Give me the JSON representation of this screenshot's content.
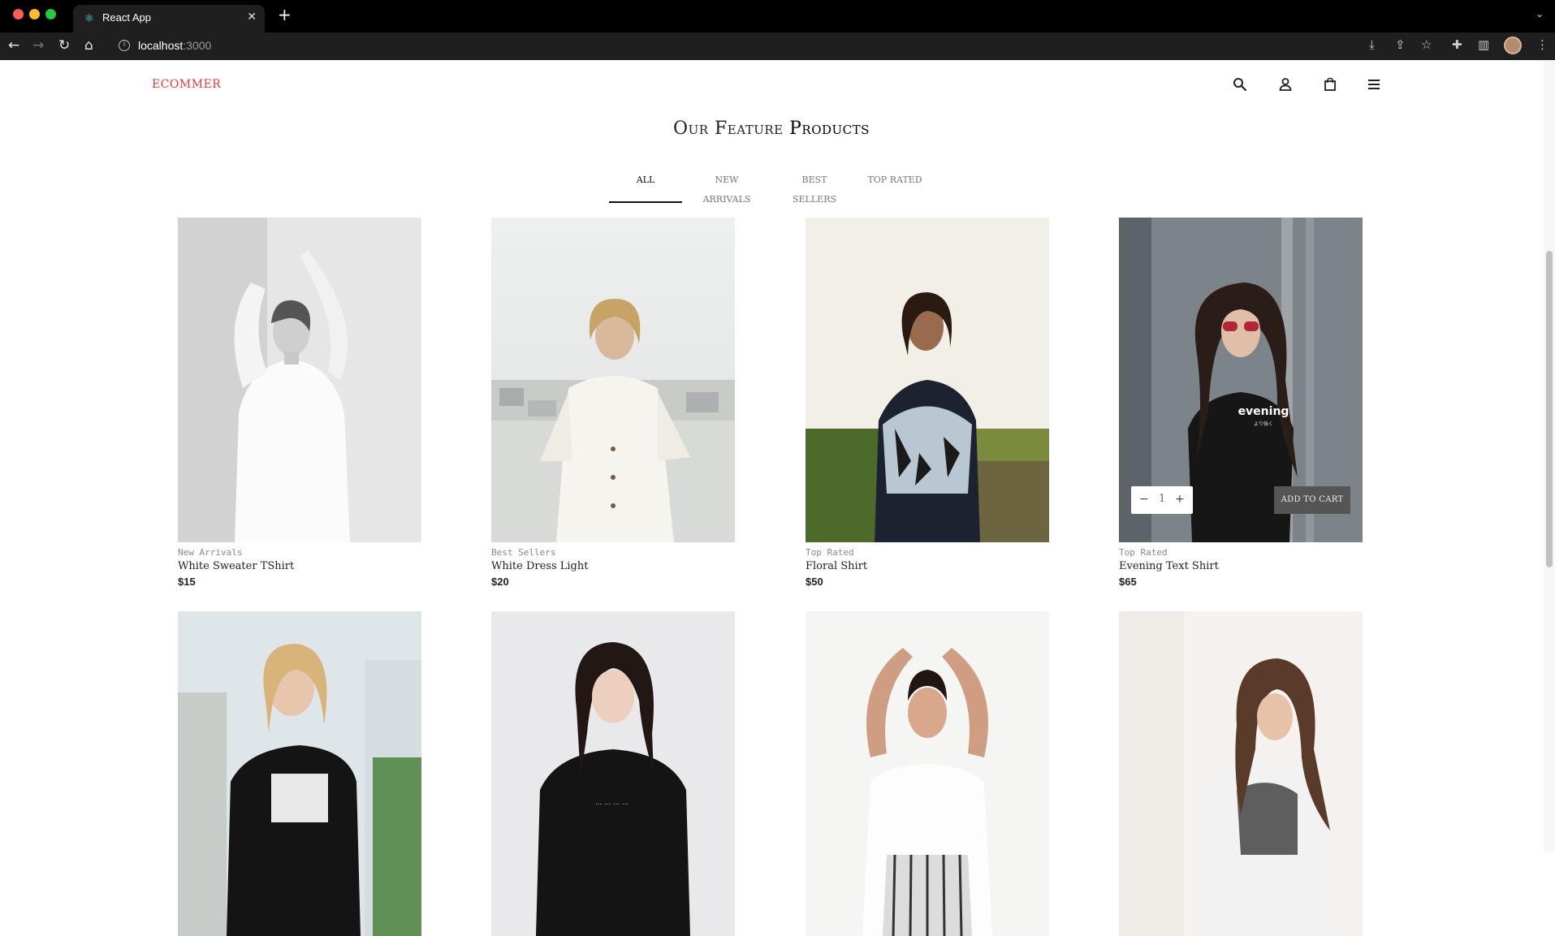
{
  "browser": {
    "tab_title": "React App",
    "tab_close": "✕",
    "new_tab": "+",
    "url_host": "localhost",
    "url_port": ":3000"
  },
  "header": {
    "brand": "ECOMMER",
    "icons": [
      "search-icon",
      "account-icon",
      "bag-icon",
      "menu-icon"
    ]
  },
  "section": {
    "title_part1": "Our Feature",
    "title_part2": "Products"
  },
  "filter_tabs": [
    {
      "label": "ALL",
      "active": true
    },
    {
      "label": "NEW ARRIVALS",
      "active": false
    },
    {
      "label": "BEST SELLERS",
      "active": false
    },
    {
      "label": "TOP RATED",
      "active": false
    }
  ],
  "products": [
    {
      "category": "New Arrivals",
      "name": "White Sweater TShirt",
      "price": "$15"
    },
    {
      "category": "Best Sellers",
      "name": "White Dress Light",
      "price": "$20"
    },
    {
      "category": "Top Rated",
      "name": "Floral Shirt",
      "price": "$50"
    },
    {
      "category": "Top Rated",
      "name": "Evening Text Shirt",
      "price": "$65",
      "shirt_text": "evening",
      "shirt_subtext": "より強く"
    },
    {},
    {},
    {},
    {}
  ],
  "hover_card": {
    "qty_minus": "−",
    "qty_value": "1",
    "qty_plus": "+",
    "add_to_cart": "ADD TO CART"
  },
  "colors": {
    "brand": "#e03a3a",
    "chrome_bg": "#1f1f1f"
  }
}
